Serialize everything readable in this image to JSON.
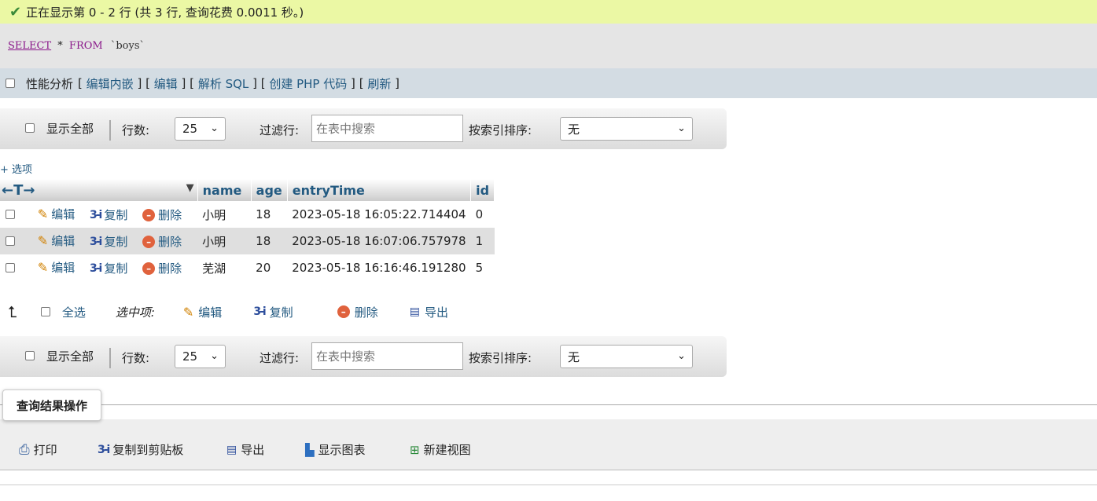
{
  "status": {
    "message": "正在显示第 0 - 2 行 (共 3 行, 查询花费 0.0011 秒。)"
  },
  "sql": {
    "kw_select": "SELECT",
    "star": "*",
    "kw_from": "FROM",
    "table": "`boys`"
  },
  "sql_tools": {
    "profiling_label": "性能分析",
    "links": [
      "编辑内嵌",
      "编辑",
      "解析 SQL",
      "创建 PHP 代码",
      "刷新"
    ]
  },
  "nav": {
    "show_all_label": "显示全部",
    "rows_label": "行数:",
    "rows_value": "25",
    "filter_label": "过滤行:",
    "filter_placeholder": "在表中搜索",
    "sort_label": "按索引排序:",
    "sort_value": "无"
  },
  "options_label": "+ 选项",
  "table": {
    "columns": [
      "name",
      "age",
      "entryTime",
      "id"
    ],
    "actions": {
      "edit": "编辑",
      "copy": "复制",
      "delete": "删除"
    },
    "rows": [
      {
        "name": "小明",
        "age": "18",
        "entryTime": "2023-05-18 16:05:22.714404",
        "id": "0"
      },
      {
        "name": "小明",
        "age": "18",
        "entryTime": "2023-05-18 16:07:06.757978",
        "id": "1"
      },
      {
        "name": "芜湖",
        "age": "20",
        "entryTime": "2023-05-18 16:16:46.191280",
        "id": "5"
      }
    ]
  },
  "bulk": {
    "check_all": "全选",
    "with_selected": "选中项:",
    "edit": "编辑",
    "copy": "复制",
    "delete": "删除",
    "export": "导出"
  },
  "query_ops": {
    "title": "查询结果操作",
    "items": [
      "打印",
      "复制到剪贴板",
      "导出",
      "显示图表",
      "新建视图"
    ]
  },
  "colors": {
    "link": "#235a81",
    "success_bg": "#ebf8a4",
    "sql_keyword": "#8b1a8b"
  }
}
